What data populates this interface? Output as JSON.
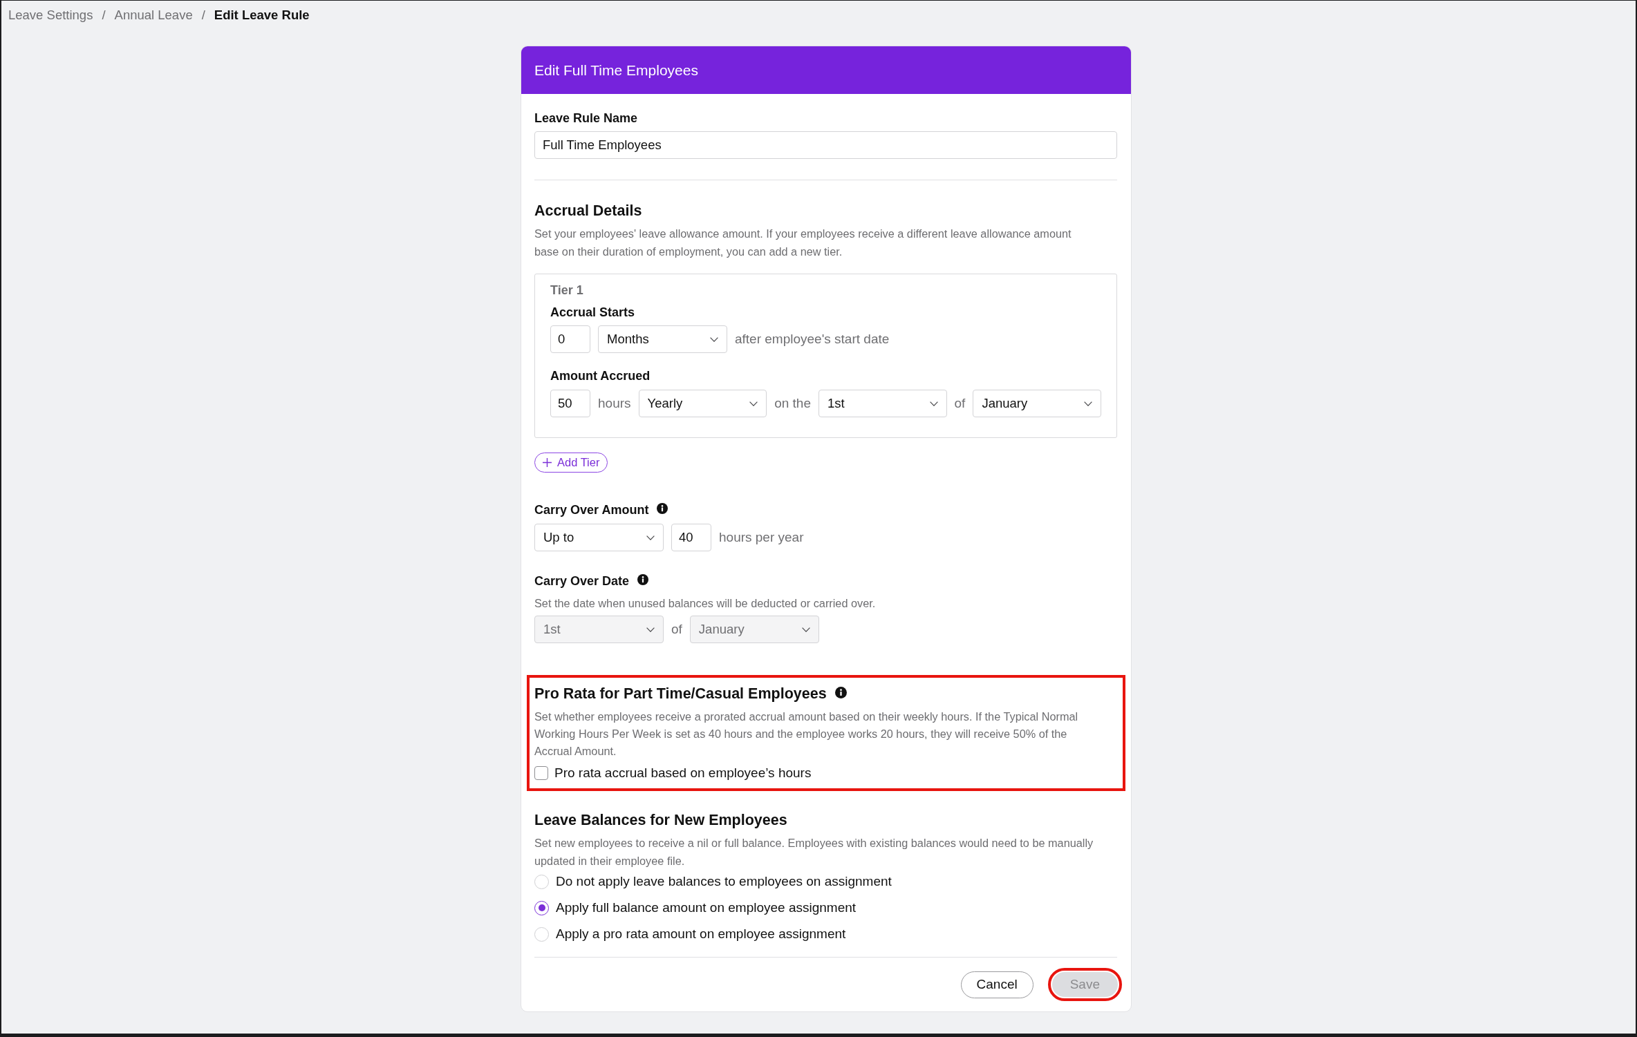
{
  "breadcrumb": {
    "separator": "/",
    "items": [
      {
        "label": "Leave Settings",
        "current": false
      },
      {
        "label": "Annual Leave",
        "current": false
      },
      {
        "label": "Edit Leave Rule",
        "current": true
      }
    ]
  },
  "dialog": {
    "title": "Edit Full Time Employees",
    "rule_name": {
      "label": "Leave Rule Name",
      "value": "Full Time Employees"
    },
    "accrual_details": {
      "heading": "Accrual Details",
      "description": "Set your employees' leave allowance amount. If your employees receive a different leave allowance amount base on their duration of employment, you can add a new tier.",
      "tiers": [
        {
          "title": "Tier 1",
          "fields": [
            {
              "label": "Accrual Starts",
              "controls": [
                {
                  "kind": "input",
                  "value": "0",
                  "disabled": false
                },
                {
                  "kind": "select",
                  "value": "Months",
                  "disabled": false
                },
                {
                  "kind": "text",
                  "text": "after employee's start date"
                }
              ]
            },
            {
              "label": "Amount Accrued",
              "controls": [
                {
                  "kind": "input",
                  "value": "50",
                  "disabled": false
                },
                {
                  "kind": "text",
                  "text": "hours"
                },
                {
                  "kind": "select",
                  "value": "Yearly",
                  "disabled": false
                },
                {
                  "kind": "text",
                  "text": "on the"
                },
                {
                  "kind": "select",
                  "value": "1st",
                  "disabled": false
                },
                {
                  "kind": "text",
                  "text": "of"
                },
                {
                  "kind": "select",
                  "value": "January",
                  "disabled": false
                }
              ]
            }
          ]
        }
      ],
      "add_tier_button": "Add Tier"
    },
    "carry_over_amount": {
      "label": "Carry Over Amount",
      "info_icon": true,
      "controls": [
        {
          "kind": "select",
          "value": "Up to",
          "disabled": false
        },
        {
          "kind": "input",
          "value": "40",
          "disabled": false
        },
        {
          "kind": "text",
          "text": "hours per year"
        }
      ]
    },
    "carry_over_date": {
      "label": "Carry Over Date",
      "info_icon": true,
      "description": "Set the date when unused balances will be deducted or carried over.",
      "controls": [
        {
          "kind": "select",
          "value": "1st",
          "disabled": true
        },
        {
          "kind": "text",
          "text": "of"
        },
        {
          "kind": "select",
          "value": "January",
          "disabled": true
        }
      ]
    },
    "pro_rata": {
      "heading": "Pro Rata for Part Time/Casual Employees",
      "info_icon": true,
      "highlighted": true,
      "description": "Set whether employees receive a prorated accrual amount based on their weekly hours. If the Typical Normal Working Hours Per Week is set as 40 hours and the employee works 20 hours, they will receive 50% of the Accrual Amount.",
      "checkbox": {
        "label": "Pro rata accrual based on employee’s hours",
        "checked": false
      }
    },
    "new_employee_balances": {
      "heading": "Leave Balances for New Employees",
      "description": "Set new employees to receive a nil or full balance. Employees with existing balances would need to be manually updated in their employee file.",
      "options": [
        {
          "label": "Do not apply leave balances to employees on assignment",
          "selected": false
        },
        {
          "label": "Apply full balance amount on employee assignment",
          "selected": true
        },
        {
          "label": "Apply a pro rata amount on employee assignment",
          "selected": false
        }
      ]
    },
    "buttons": [
      {
        "label": "Cancel",
        "kind": "secondary",
        "disabled": false,
        "highlighted": false
      },
      {
        "label": "Save",
        "kind": "primary",
        "disabled": true,
        "highlighted": true
      }
    ]
  }
}
